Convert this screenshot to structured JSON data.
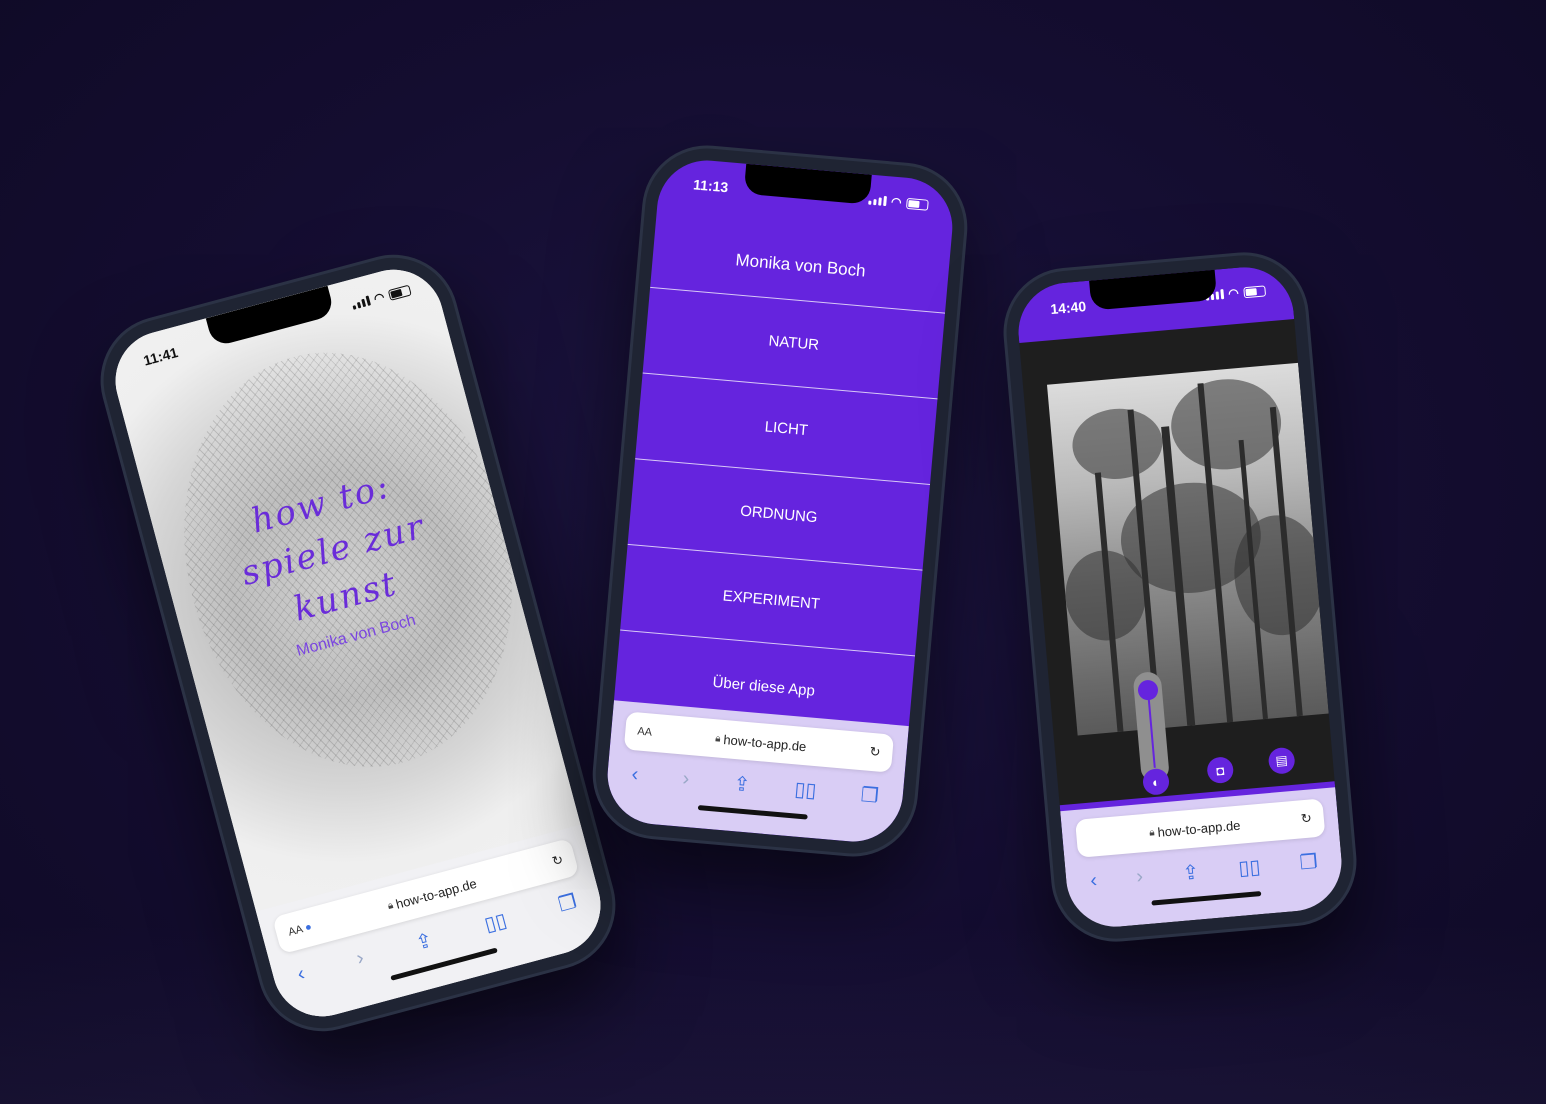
{
  "phone1": {
    "time": "11:41",
    "title_lines": [
      "how to:",
      "spiele zur",
      "kunst"
    ],
    "author": "Monika von Boch",
    "url": "how-to-app.de",
    "aa": "AA"
  },
  "phone2": {
    "time": "11:13",
    "menu_title": "Monika von Boch",
    "menu_items": [
      "NATUR",
      "LICHT",
      "ORDNUNG",
      "EXPERIMENT",
      "Über diese App"
    ],
    "url": "how-to-app.de",
    "aa": "AA"
  },
  "phone3": {
    "time": "14:40",
    "url": "how-to-app.de"
  },
  "colors": {
    "accent": "#6524de",
    "background": "#140d30",
    "safari_link": "#3b6fe0"
  },
  "icons": {
    "back": "chevron-left-icon",
    "forward": "chevron-right-icon",
    "share": "share-icon",
    "bookmarks": "book-icon",
    "tabs": "tabs-icon",
    "reload": "reload-icon",
    "undo": "undo-icon",
    "camera": "camera-icon",
    "info": "info-icon",
    "download": "download-icon",
    "next": "arrow-right-icon",
    "contrast": "contrast-icon",
    "frame": "frame-icon",
    "calendar": "calendar-icon"
  }
}
